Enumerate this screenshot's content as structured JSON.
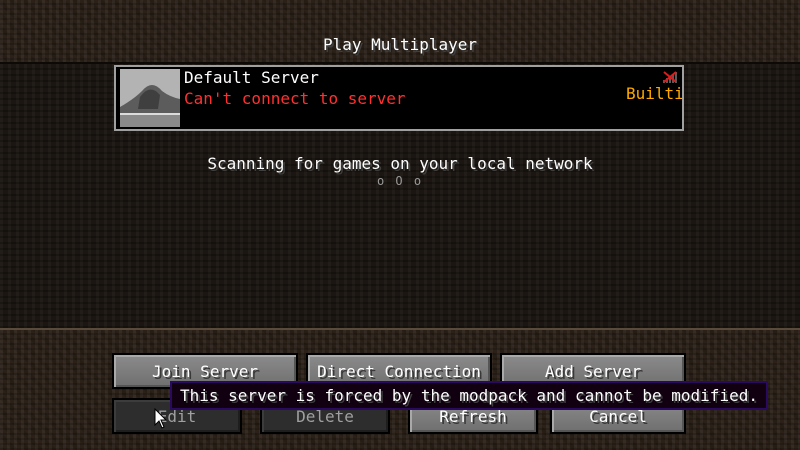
{
  "screen": {
    "title": "Play Multiplayer"
  },
  "servers": [
    {
      "name": "Default Server",
      "status": "Can't connect to server",
      "tag": "Builtin",
      "icon": "landscape-thumbnail-icon",
      "ping_icon": "no-connection-icon"
    }
  ],
  "lan": {
    "scanning_text": "Scanning for games on your local network",
    "indicator": "o O o"
  },
  "buttons": {
    "join": "Join Server",
    "direct": "Direct Connection",
    "add": "Add Server",
    "edit": "Edit",
    "delete": "Delete",
    "refresh": "Refresh",
    "cancel": "Cancel"
  },
  "tooltip": {
    "text": "This server is forced by the modpack and cannot be modified."
  },
  "colors": {
    "status_error": "#ff3030",
    "tag": "#ffaa00",
    "tooltip_border": "#2a0a5e"
  }
}
